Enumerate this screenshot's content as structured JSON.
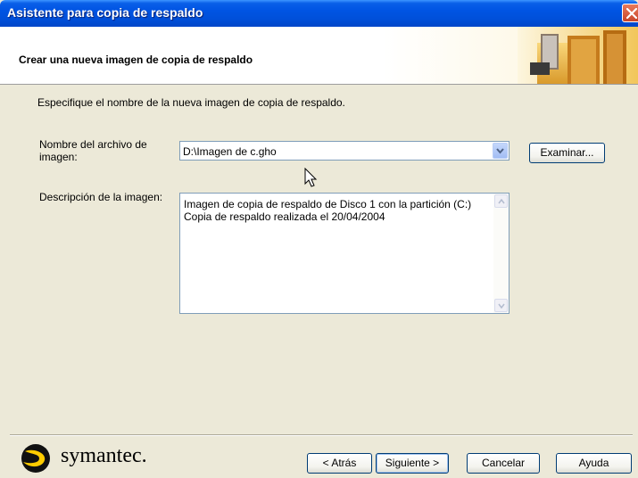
{
  "window": {
    "title": "Asistente para copia de respaldo"
  },
  "header": {
    "title": "Crear una nueva imagen de copia de respaldo"
  },
  "instruction": "Especifique el nombre de la nueva imagen de copia de respaldo.",
  "form": {
    "filename_label": "Nombre del archivo de imagen:",
    "filename_value": "D:\\Imagen de c.gho",
    "browse_label": "Examinar...",
    "description_label": "Descripción de la imagen:",
    "description_lines": [
      "Imagen de copia de respaldo de Disco 1 con la partición (C:)",
      "Copia de respaldo realizada el 20/04/2004"
    ]
  },
  "footer": {
    "brand": "symantec.",
    "back_label": "< Atrás",
    "next_label": "Siguiente >",
    "cancel_label": "Cancelar",
    "help_label": "Ayuda"
  },
  "colors": {
    "titlebar": "#0054e3",
    "dialog_bg": "#ece9d8",
    "header_accent": "#f7c94a",
    "brand_yellow": "#ffcc00"
  }
}
